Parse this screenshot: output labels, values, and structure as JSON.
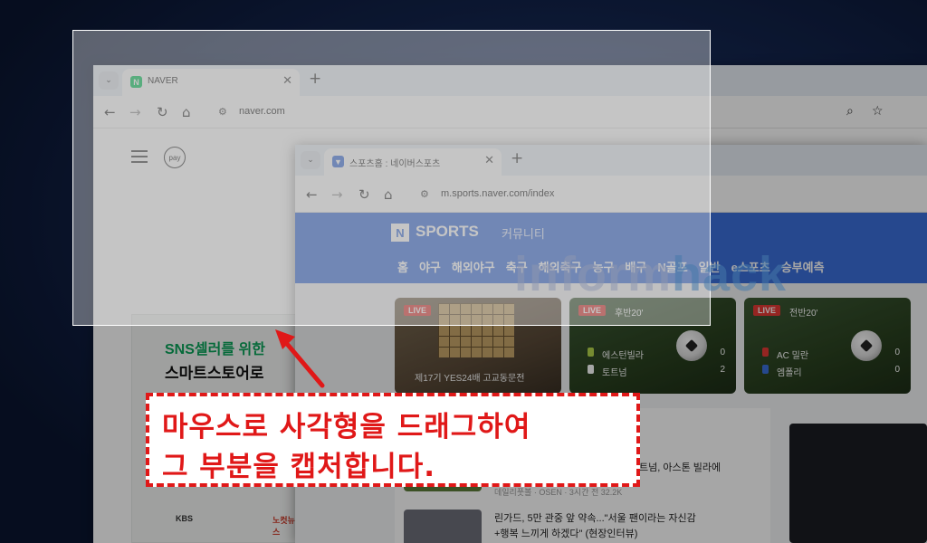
{
  "window1": {
    "tab_title": "NAVER",
    "favicon_letter": "N",
    "favicon_color": "#03c75a",
    "url": "naver.com",
    "pay_label": "pay",
    "ad_line1": "SNS셀러를 위한",
    "ad_line2": "스마트스토어로",
    "logo_left": "KBS",
    "logo_right": "노컷뉴스"
  },
  "window2": {
    "tab_title": "스포츠홈 : 네이버스포츠",
    "url": "m.sports.naver.com/index",
    "brand_letter": "N",
    "brand": "SPORTS",
    "community": "커뮤니티",
    "nav": [
      "홈",
      "야구",
      "해외야구",
      "축구",
      "해외축구",
      "농구",
      "배구",
      "N골프",
      "일반",
      "e스포츠",
      "승부예측"
    ],
    "live_label": "LIVE",
    "card1_caption": "제17기 YES24배 고교동문전",
    "card2": {
      "time": "후반20'",
      "team1": "에스턴빌라",
      "score1": "0",
      "team2": "토트넘",
      "score2": "2"
    },
    "card3": {
      "time": "전반20'",
      "team1": "AC 밀란",
      "score1": "0",
      "team2": "엠폴리",
      "score2": "0"
    },
    "news1": "트넘, 아스톤 빌라에",
    "news1_sub": "데일리풋볼 · OSEN · 3시간 전 32.2K",
    "news2": "린가드, 5만 관중 앞 약속...\"서울 팬이라는 자신감",
    "news2_b": "+행복 느끼게 하겠다\" (현장인터뷰)"
  },
  "colors": {
    "sports_blue": "#3b6fdb",
    "live_red": "#e53935",
    "callout_red": "#e01818"
  },
  "watermark": {
    "part1": "inform",
    "part2": "hack"
  },
  "callout": {
    "line1": "마우스로 사각형을 드래그하여",
    "line2": "그 부분을 캡처합니다."
  },
  "icons": {
    "back": "←",
    "forward": "→",
    "reload": "↻",
    "home": "⌂",
    "close": "✕",
    "plus": "+",
    "chevron": "⌄",
    "tune": "⚙",
    "zoom": "⌕",
    "star": "☆"
  }
}
